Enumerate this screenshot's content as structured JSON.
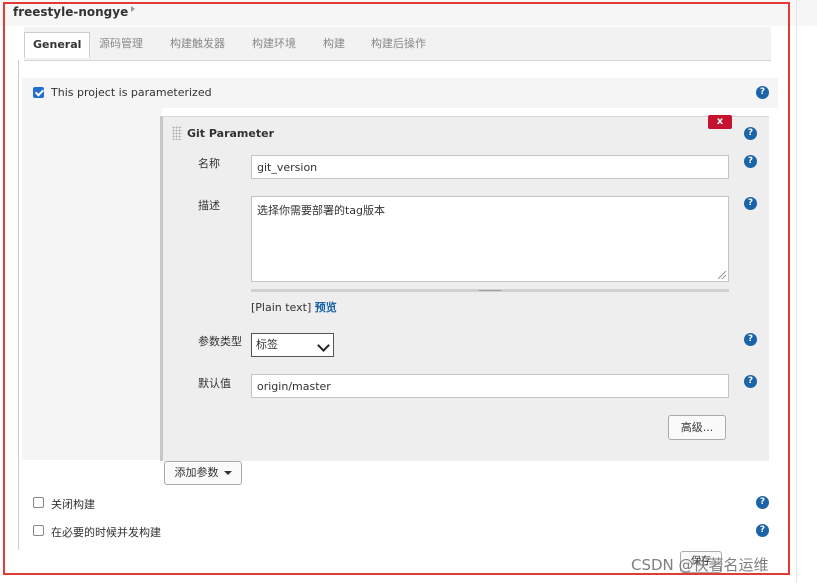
{
  "breadcrumb": {
    "job_name": "freestyle-nongye"
  },
  "tabs": [
    {
      "label": "General",
      "active": true
    },
    {
      "label": "源码管理"
    },
    {
      "label": "构建触发器"
    },
    {
      "label": "构建环境"
    },
    {
      "label": "构建"
    },
    {
      "label": "构建后操作"
    }
  ],
  "options": {
    "parameterized": {
      "label": "This project is parameterized",
      "checked": true
    },
    "disable_build": {
      "label": "关闭构建",
      "checked": false
    },
    "concurrent_build": {
      "label": "在必要的时候并发构建",
      "checked": false
    }
  },
  "git_parameter": {
    "title": "Git Parameter",
    "delete_label": "x",
    "name_label": "名称",
    "name_value": "git_version",
    "description_label": "描述",
    "description_value": "选择你需要部署的tag版本",
    "plain_text": "[Plain text]",
    "preview_link": "预览",
    "type_label": "参数类型",
    "type_selected": "标签",
    "default_label": "默认值",
    "default_value": "origin/master",
    "advanced_button": "高级..."
  },
  "add_parameter_button": "添加参数",
  "help_glyph": "?",
  "footer": {
    "watermark": "CSDN @佚著名运维",
    "save_button": "保存"
  },
  "colors": {
    "accent_blue": "#1c64a8",
    "delete_red": "#c4122f",
    "highlight_outline": "#e53935"
  }
}
